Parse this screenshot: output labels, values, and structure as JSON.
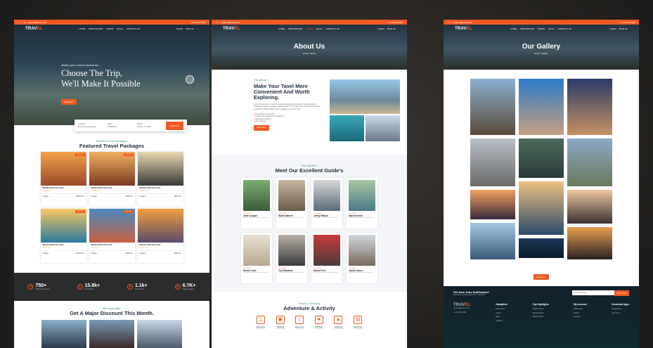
{
  "colors": {
    "accent": "#f15a22",
    "teal": "#2b8a7e",
    "navy": "#1e2a3a"
  },
  "topbar": {
    "phone": "+1 234 567 890",
    "email": "support@travel.com",
    "hours": "Sun - Fri: 9AM - 7PM"
  },
  "nav": {
    "logo_a": "TRAV",
    "logo_b": "EL",
    "items": [
      "HOME",
      "DESTINATION",
      "PAGES",
      "BLOG",
      "CONTACT US"
    ],
    "login": "LOGIN",
    "signup": "SIGN UP"
  },
  "home": {
    "hero_tag": "Make your tours awesome",
    "hero_line1": "Choose The Trip,",
    "hero_line2": "We'll Make It Possible",
    "hero_cta": "View More",
    "search": {
      "location_label": "Location",
      "location_value": "Where are you going?",
      "date_label": "Date",
      "date_value": "12/20/2023",
      "guests_label": "Guests",
      "guests_value": "1 Adult - 2 Child",
      "button": "Find Now"
    },
    "featured_tag": "Popular Travel Packages",
    "featured_title": "Featured Travel Packages",
    "packages": [
      {
        "badge": "Save 10%",
        "title": "Masteria Red City Land",
        "price": "$1250.00",
        "meta": "4 Days"
      },
      {
        "badge": "Save 10%",
        "title": "Masteria Red City Land",
        "price": "$950.00",
        "meta": "4 Days"
      },
      {
        "badge": "",
        "title": "Masteria Red City Land",
        "price": "$900.00",
        "meta": "4 Days"
      },
      {
        "badge": "Save 10%",
        "title": "Masteria Red City Land",
        "price": "$1000.00",
        "meta": "4 Days"
      },
      {
        "badge": "Save 10%",
        "title": "Masteria Red City Land",
        "price": "$800.00",
        "meta": "4 Days"
      },
      {
        "badge": "",
        "title": "Masteria Red City Land",
        "price": "$900.00",
        "meta": "4 Days"
      }
    ],
    "stats": [
      {
        "value": "750+",
        "label": "Total Travel Agents"
      },
      {
        "value": "15.8k+",
        "label": "Destinations"
      },
      {
        "value": "1.1k+",
        "label": "Tour Guides"
      },
      {
        "value": "6.7K+",
        "label": "Happy travelers"
      }
    ],
    "discount_tag": "Discount offer",
    "discount_title": "Get A Major Discount This Month."
  },
  "about": {
    "title": "About Us",
    "crumb": "Home / About",
    "tag": "Get About",
    "heading": "Make Your Tavel More Convenient And Worth Exploring.",
    "body": "Lorem ipsum dolor sit amet consectetur adipiscing elit sed do eiusmod tempor incididunt ut labore et dolore magna aliqua. Ut enim ad minim veniam quis nostrud exercitation ullamco laboris nisi ut aliquip ex ea commodo.",
    "bullets": [
      "Personalized Itineraries",
      "Insider Tips and Recommendations",
      "Seamless Logistics",
      "24/7 Support"
    ],
    "button": "View More",
    "guides_tag": "Our Guide's",
    "guides_title": "Meet Our Excellent Guide's",
    "guides": [
      {
        "role": "Tour Guide",
        "name": "Jane Cooper"
      },
      {
        "role": "Tour Guide",
        "name": "Wade Warren"
      },
      {
        "role": "Tour Guide",
        "name": "Jenny Wilson"
      },
      {
        "role": "Tour Guide",
        "name": "Marvin Kheli"
      },
      {
        "role": "Tour Guide",
        "name": "Devon Lane"
      },
      {
        "role": "Tour Guide",
        "name": "Cuy Hawkins"
      },
      {
        "role": "Tour Guide",
        "name": "Robert Fox"
      },
      {
        "role": "Tour Guide",
        "name": "Jacob Jones"
      }
    ],
    "guide_desc": "Lorem ipsum dolor sit amet consectetur",
    "activity_tag": "Travel & Activity",
    "activity_title": "Adventure & Activity",
    "activities": [
      {
        "name": "Adventure",
        "sub": "10 Destinations"
      },
      {
        "name": "Trekking",
        "sub": "12 Destinations"
      },
      {
        "name": "Camp Fire",
        "sub": "7 Destinations"
      },
      {
        "name": "Off Road",
        "sub": "15 Destinations"
      },
      {
        "name": "Camping",
        "sub": "13 Destinations"
      },
      {
        "name": "Exploring",
        "sub": "25 Destinations"
      }
    ]
  },
  "gallery": {
    "title": "Our Gallery",
    "crumb": "Home / Gallery",
    "button": "View More",
    "newsletter_title": "Get New Jobs Notification!",
    "newsletter_sub": "Subscribe & get all related jobs notification",
    "newsletter_placeholder": "Enter your email",
    "newsletter_button": "Subscribe",
    "footer_cols": [
      {
        "h": "Navigation",
        "items": [
          "Destination",
          "Pages",
          "Blog",
          "Contact",
          "About"
        ]
      },
      {
        "h": "Top Highlights",
        "items": [
          "Masteria Red",
          "Masteria Red",
          "Masteria Red",
          "Masteria Red"
        ]
      },
      {
        "h": "My Account",
        "items": [
          "Dashboard",
          "Profile",
          "Settings",
          "Logout"
        ]
      },
      {
        "h": "Download Apps",
        "items": [
          "Google Play",
          "App Store"
        ]
      }
    ]
  }
}
